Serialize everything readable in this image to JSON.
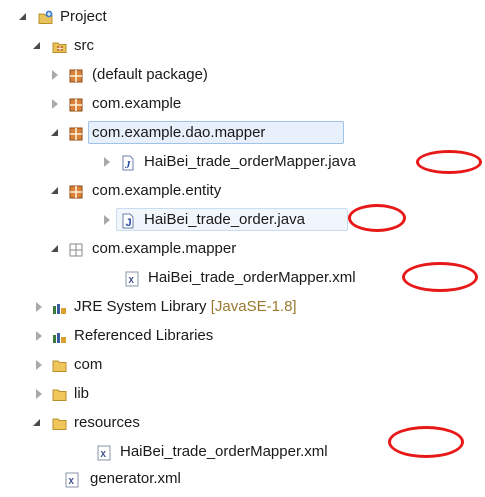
{
  "tree": {
    "project": "Project",
    "src": "src",
    "default_package": "(default package)",
    "com_example": "com.example",
    "dao_mapper": "com.example.dao.mapper",
    "mapper_java": "HaiBei_trade_orderMapper.java",
    "entity": "com.example.entity",
    "order_java": "HaiBei_trade_order.java",
    "mapper_pkg": "com.example.mapper",
    "mapper_xml": "HaiBei_trade_orderMapper.xml",
    "jre": "JRE System Library",
    "jre_version": "[JavaSE-1.8]",
    "referenced_libraries": "Referenced Libraries",
    "com": "com",
    "lib": "lib",
    "resources": "resources",
    "resources_mapper_xml": "HaiBei_trade_orderMapper.xml",
    "generator_xml": "generator.xml"
  },
  "icons": {
    "project": "java-project-icon",
    "source_folder": "source-folder-icon",
    "package": "package-icon",
    "empty_package": "empty-package-icon",
    "java_interface": "java-interface-icon",
    "java_class": "java-class-icon",
    "xml_file": "xml-file-icon",
    "library": "library-icon",
    "folder": "folder-icon"
  },
  "colors": {
    "annotation_red": "#e81818",
    "selection_border": "#9fc3e8",
    "package_brown": "#c87a2e",
    "folder_yellow": "#e6b84c"
  }
}
